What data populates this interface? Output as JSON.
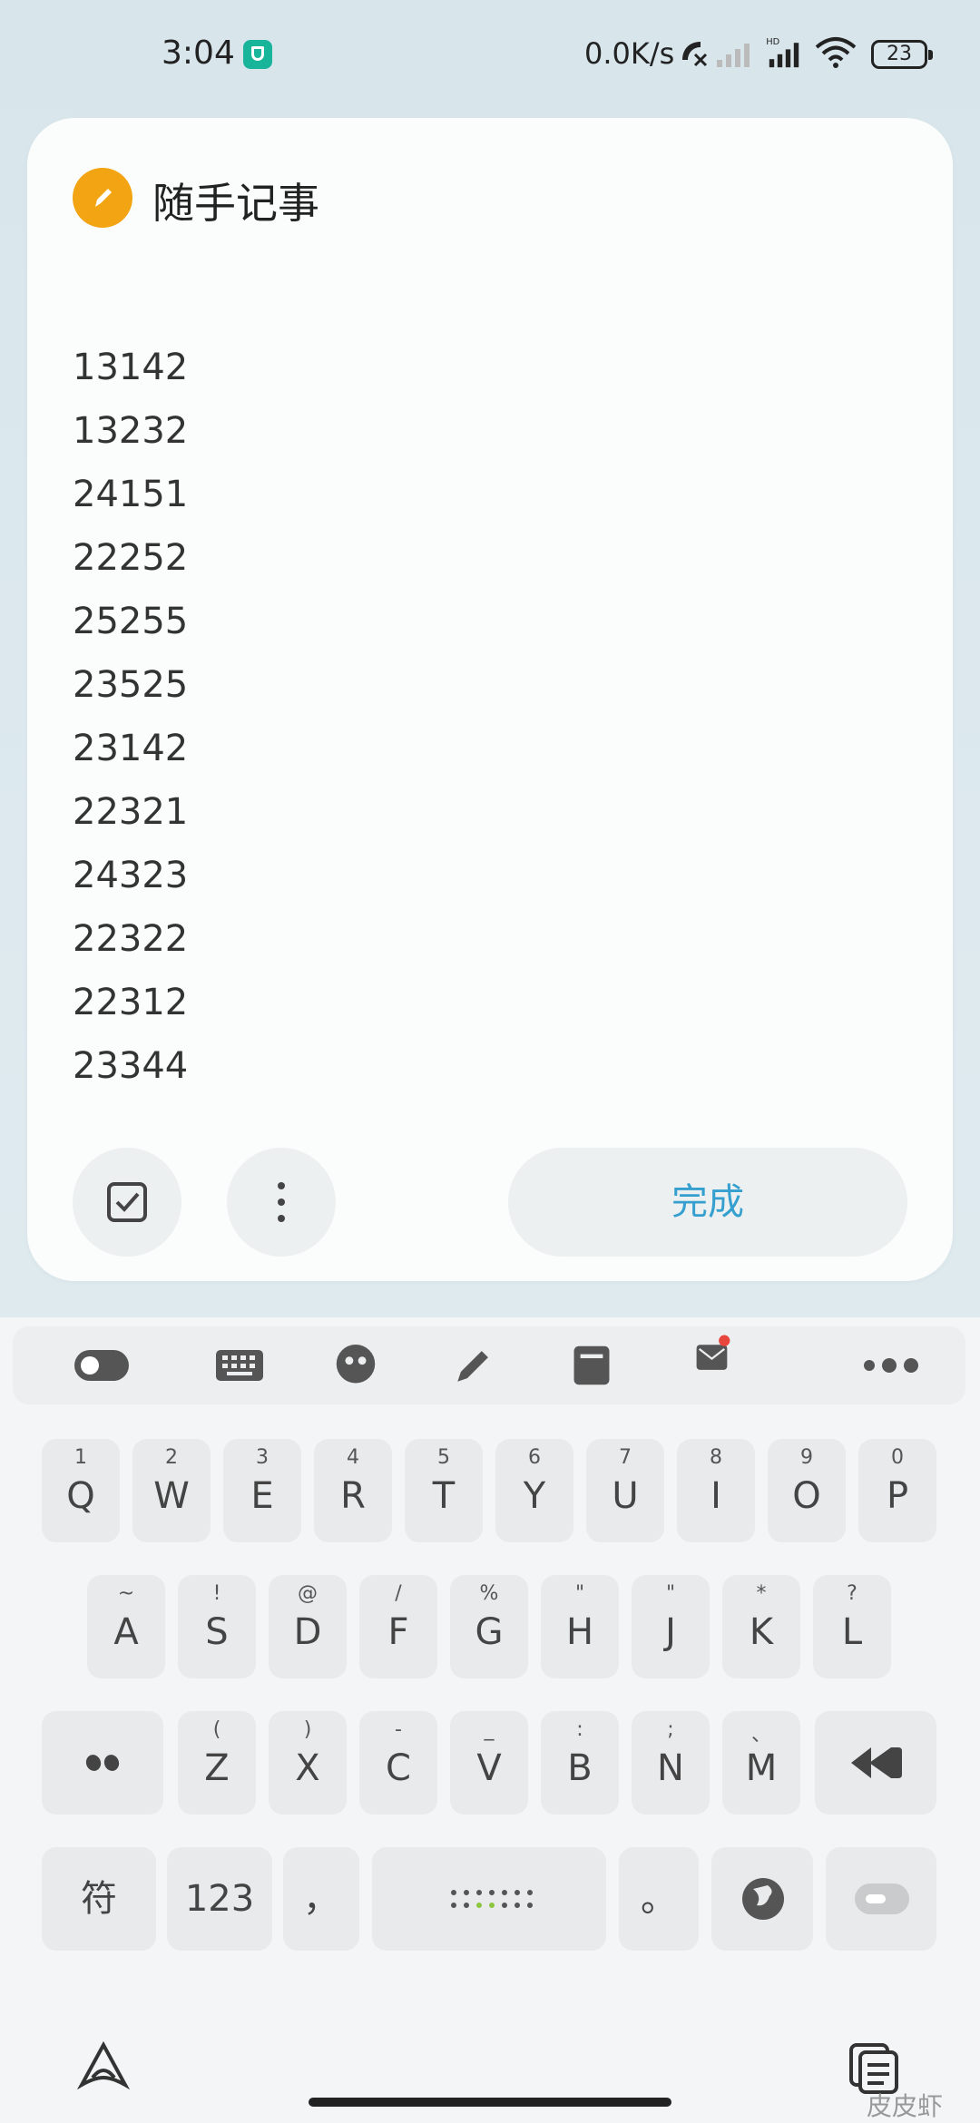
{
  "status_bar": {
    "time": "3:04",
    "network_speed": "0.0K/s",
    "battery": "23",
    "icons": [
      "shield-icon",
      "call-off-icon",
      "signal-weak-icon",
      "signal-hd-icon",
      "wifi-icon",
      "battery-icon"
    ]
  },
  "note": {
    "title": "随手记事",
    "lines": [
      "13142",
      "13232",
      "24151",
      "22252",
      "25255",
      "23525",
      "23142",
      "22321",
      "24323",
      "22322",
      "22312",
      "23344"
    ],
    "done_label": "完成",
    "accent": "#f2a413",
    "done_color": "#35a0cf"
  },
  "keyboard": {
    "toolbar_icons": [
      "toggle-icon",
      "keyboard-icon",
      "emoji-icon",
      "handwriting-icon",
      "clipboard-icon",
      "mail-icon",
      "more-icon"
    ],
    "row1": [
      {
        "main": "Q",
        "sub": "1"
      },
      {
        "main": "W",
        "sub": "2"
      },
      {
        "main": "E",
        "sub": "3"
      },
      {
        "main": "R",
        "sub": "4"
      },
      {
        "main": "T",
        "sub": "5"
      },
      {
        "main": "Y",
        "sub": "6"
      },
      {
        "main": "U",
        "sub": "7"
      },
      {
        "main": "I",
        "sub": "8"
      },
      {
        "main": "O",
        "sub": "9"
      },
      {
        "main": "P",
        "sub": "0"
      }
    ],
    "row2": [
      {
        "main": "A",
        "sub": "~"
      },
      {
        "main": "S",
        "sub": "!"
      },
      {
        "main": "D",
        "sub": "@"
      },
      {
        "main": "F",
        "sub": "/"
      },
      {
        "main": "G",
        "sub": "%"
      },
      {
        "main": "H",
        "sub": "\""
      },
      {
        "main": "J",
        "sub": "\""
      },
      {
        "main": "K",
        "sub": "*"
      },
      {
        "main": "L",
        "sub": "?"
      }
    ],
    "row3": [
      {
        "main": "Z",
        "sub": "("
      },
      {
        "main": "X",
        "sub": ")"
      },
      {
        "main": "C",
        "sub": "-"
      },
      {
        "main": "V",
        "sub": "_"
      },
      {
        "main": "B",
        "sub": ":"
      },
      {
        "main": "N",
        "sub": ";"
      },
      {
        "main": "M",
        "sub": "、"
      }
    ],
    "symbol_key": "符",
    "num_key": "123",
    "comma_key": "，",
    "period_key": "。"
  },
  "watermark": "皮皮虾"
}
